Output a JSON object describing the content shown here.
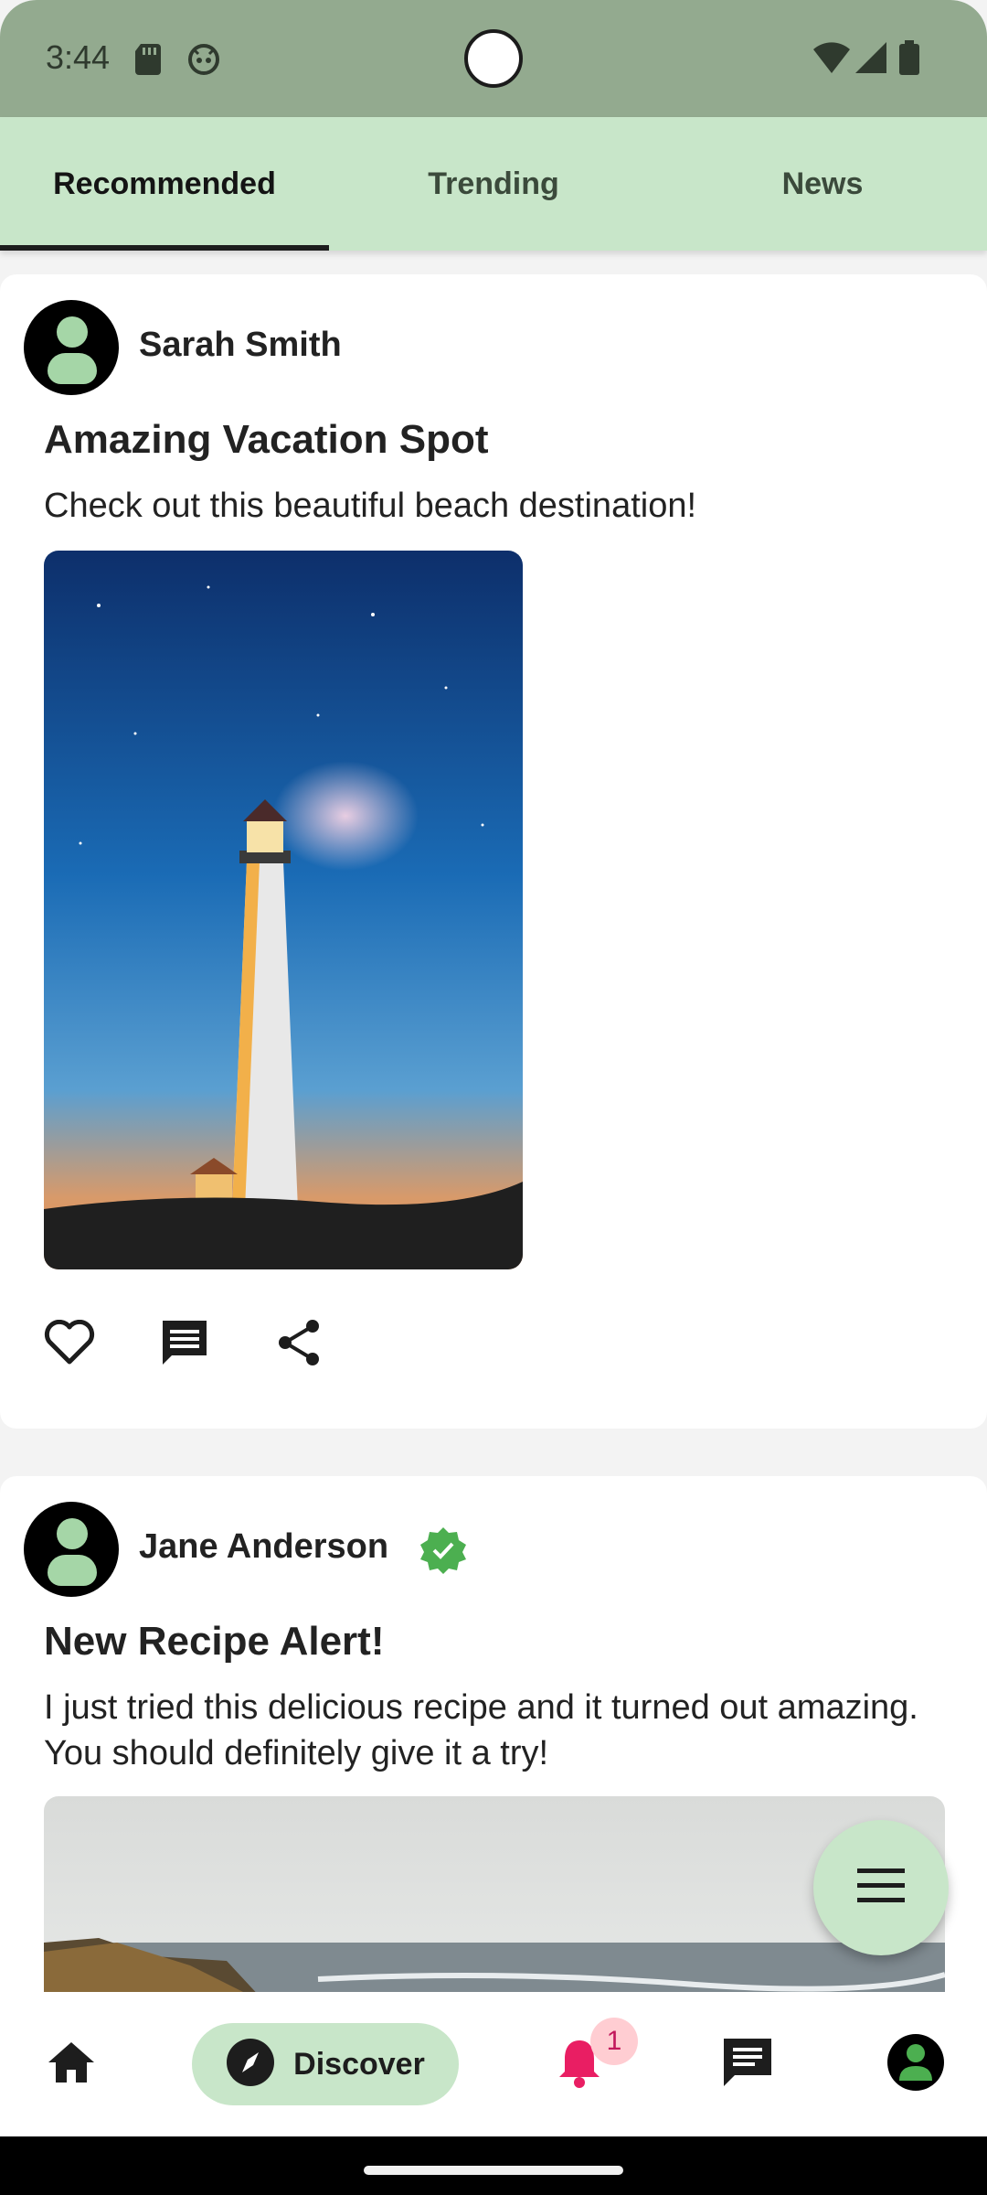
{
  "status_bar": {
    "time": "3:44",
    "icons": [
      "sd-card-icon",
      "android-face-icon",
      "wifi-icon",
      "signal-icon",
      "battery-icon"
    ]
  },
  "tabs": [
    {
      "label": "Recommended",
      "active": true
    },
    {
      "label": "Trending",
      "active": false
    },
    {
      "label": "News",
      "active": false
    }
  ],
  "posts": [
    {
      "author": "Sarah Smith",
      "verified": false,
      "title": "Amazing Vacation Spot",
      "body": "Check out this beautiful beach destination!",
      "image": "lighthouse-night-photo"
    },
    {
      "author": "Jane Anderson",
      "verified": true,
      "title": "New Recipe Alert!",
      "body": "I just tried this delicious recipe and it turned out amazing. You should definitely give it a try!",
      "image": "coast-sea-photo"
    }
  ],
  "actions": [
    "heart-icon",
    "comment-icon",
    "share-icon"
  ],
  "bottom_nav": {
    "discover_label": "Discover",
    "notification_count": "1"
  },
  "colors": {
    "status_bar": "#93aa8f",
    "tab_bar": "#c8e6c9",
    "accent_green": "#4caf50",
    "notification": "#e91e63"
  }
}
